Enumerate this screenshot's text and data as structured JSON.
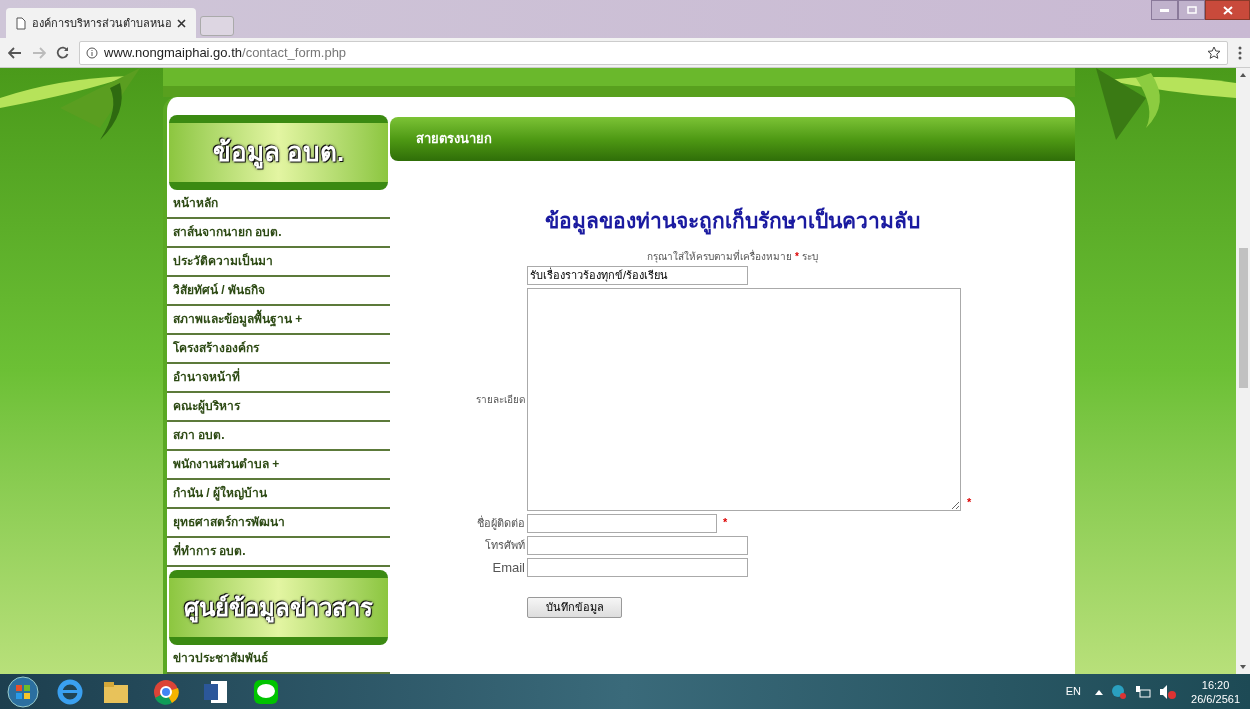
{
  "browser": {
    "tab_title": "องค์การบริหารส่วนตำบลหนอ",
    "url_host": "www.nongmaiphai.go.th",
    "url_path": "/contact_form.php"
  },
  "sidebar": {
    "banner": "ข้อมูล อบต.",
    "items": [
      {
        "label": "หน้าหลัก"
      },
      {
        "label": "สาส์นจากนายก อบต."
      },
      {
        "label": "ประวัติความเป็นมา"
      },
      {
        "label": "วิสัยทัศน์ / พันธกิจ"
      },
      {
        "label": "สภาพและข้อมูลพื้นฐาน +"
      },
      {
        "label": "โครงสร้างองค์กร"
      },
      {
        "label": "อำนาจหน้าที่"
      },
      {
        "label": "คณะผู้บริหาร"
      },
      {
        "label": "สภา อบต."
      },
      {
        "label": "พนักงานส่วนตำบล +"
      },
      {
        "label": "กำนัน / ผู้ใหญ่บ้าน"
      },
      {
        "label": "ยุทธศาสตร์การพัฒนา"
      },
      {
        "label": "ที่ทำการ อบต."
      }
    ],
    "banner_2": "ศูนย์ข้อมูลข่าวสาร",
    "items_2": [
      {
        "label": "ข่าวประชาสัมพันธ์"
      }
    ]
  },
  "header": "สายตรงนายก",
  "form": {
    "heading": "ข้อมูลของท่านจะถูกเก็บรักษาเป็นความลับ",
    "note": "กรุณาใส่ให้ครบตามที่เครื่องหมาย",
    "note_mark": "*",
    "note_end": "ระบุ",
    "fields": [
      {
        "kind": "text",
        "value": "รับเรื่องราวร้องทุกข์/ร้องเรียน"
      },
      {
        "kind": "textarea",
        "label": "รายละเอียด",
        "mark": "*"
      },
      {
        "kind": "short",
        "label": "ชื่อผู้ติดต่อ",
        "mark": "*"
      },
      {
        "kind": "text",
        "label": "โทรศัพท์"
      },
      {
        "kind": "text",
        "label": "Email"
      }
    ],
    "submit": "บันทึกข้อมูล"
  },
  "taskbar": {
    "language": "EN",
    "time": "16:20",
    "date": "26/6/2561"
  }
}
